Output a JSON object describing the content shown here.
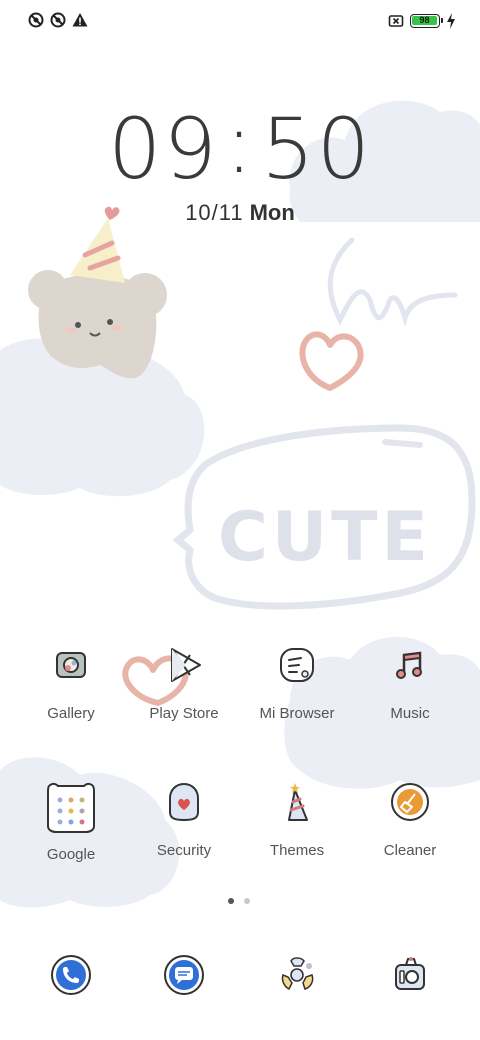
{
  "status_bar": {
    "left_icons": [
      "no-signal-icon",
      "no-data-icon",
      "warning-icon"
    ],
    "right_icons": [
      "no-sim-icon",
      "battery-icon",
      "charging-icon"
    ],
    "battery_level": "98"
  },
  "lockscreen": {
    "time_hours": "09",
    "time_separator": ":",
    "time_minutes": "50",
    "date": "10/11",
    "weekday": "Mon"
  },
  "wallpaper": {
    "sticker_text": "CUTE"
  },
  "apps": [
    {
      "label": "Gallery",
      "icon": "gallery-icon"
    },
    {
      "label": "Play Store",
      "icon": "play-store-icon"
    },
    {
      "label": "Mi Browser",
      "icon": "browser-icon"
    },
    {
      "label": "Music",
      "icon": "music-icon"
    },
    {
      "label": "Google",
      "icon": "google-folder-icon"
    },
    {
      "label": "Security",
      "icon": "security-icon"
    },
    {
      "label": "Themes",
      "icon": "themes-icon"
    },
    {
      "label": "Cleaner",
      "icon": "cleaner-icon"
    }
  ],
  "page_indicator": {
    "pages": 2,
    "current": 1
  },
  "dock": [
    "phone-icon",
    "messages-icon",
    "chrome-icon",
    "camera-icon"
  ],
  "colors": {
    "battery_green": "#36c24b",
    "cloud": "#eceef5",
    "heart": "#e8b4a8",
    "accent_blue": "#2f6fd6"
  }
}
